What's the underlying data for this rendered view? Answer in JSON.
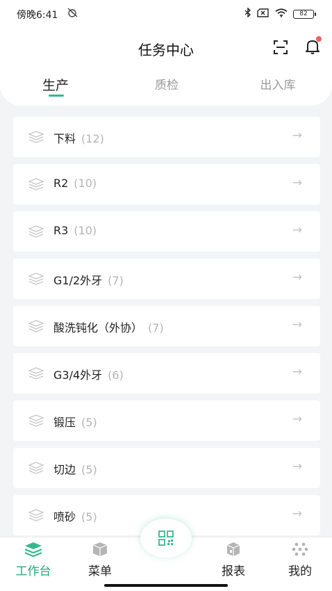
{
  "status": {
    "time": "傍晚6:41",
    "battery": "82"
  },
  "header": {
    "title": "任务中心"
  },
  "tabs": [
    {
      "label": "生产"
    },
    {
      "label": "质检"
    },
    {
      "label": "出入库"
    }
  ],
  "tasks": [
    {
      "name": "下料",
      "count": "(12)"
    },
    {
      "name": "R2",
      "count": "(10)"
    },
    {
      "name": "R3",
      "count": "(10)"
    },
    {
      "name": "G1/2外牙",
      "count": "(7)"
    },
    {
      "name": "酸洗钝化（外协）",
      "count": "(7)"
    },
    {
      "name": "G3/4外牙",
      "count": "(6)"
    },
    {
      "name": "锻压",
      "count": "(5)"
    },
    {
      "name": "切边",
      "count": "(5)"
    },
    {
      "name": "喷砂",
      "count": "(5)"
    }
  ],
  "nav": {
    "workbench": "工作台",
    "menu": "菜单",
    "report": "报表",
    "mine": "我的"
  },
  "colors": {
    "accent": "#35b98d",
    "active_text": "#2aa57a",
    "badge": "#f0605c"
  },
  "icons": {
    "status_left": "muted-alarm-icon",
    "status_right": [
      "bluetooth-icon",
      "no-sim-icon",
      "wifi-icon",
      "battery-icon"
    ],
    "header": [
      "scan-icon",
      "bell-icon"
    ],
    "item": "layers-icon",
    "arrow": "arrow-right-icon",
    "center": "qr-code-icon"
  }
}
